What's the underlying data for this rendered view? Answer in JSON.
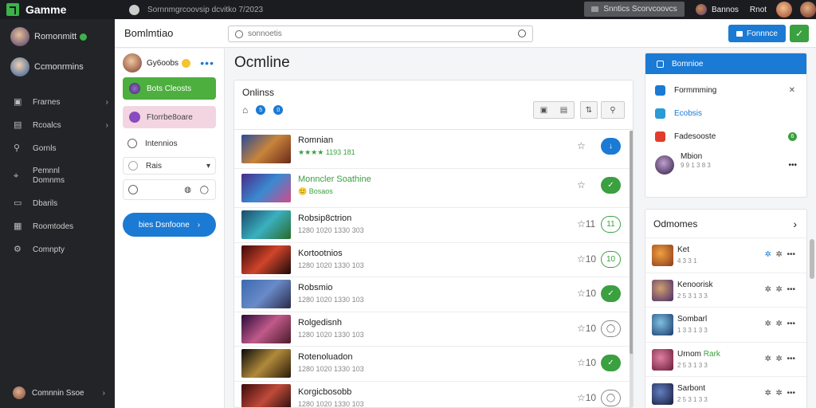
{
  "app": {
    "title": "Gamme"
  },
  "topbar": {
    "search_text": "Sornnmgrcoovsip dcvitko 7/2023",
    "button_label": "Snntics Scorvcoovcs",
    "user_name": "Bannos",
    "user_label": "Rnot"
  },
  "sidebar": {
    "users": [
      {
        "name": "Romonmitt",
        "status_color": "#3bb34a"
      },
      {
        "name": "Ccmonrmins"
      }
    ],
    "items": [
      {
        "label": "Frarnes",
        "icon": "gamepad-icon",
        "glyph": "▣",
        "chevron": true
      },
      {
        "label": "Rcoalcs",
        "icon": "bag-icon",
        "glyph": "▤",
        "chevron": true
      },
      {
        "label": "Gornls",
        "icon": "search-icon",
        "glyph": "⚲",
        "chevron": false
      },
      {
        "label": "Pemnnl Domnms",
        "icon": "pin-icon",
        "glyph": "⌖",
        "chevron": false
      },
      {
        "label": "Dbarils",
        "icon": "monitor-icon",
        "glyph": "▭",
        "chevron": false
      },
      {
        "label": "Roomtodes",
        "icon": "grid-icon",
        "glyph": "▦",
        "chevron": false
      },
      {
        "label": "Comnpty",
        "icon": "settings-icon",
        "glyph": "⚙",
        "chevron": false
      }
    ],
    "bottom_label": "Comnnin Ssoe"
  },
  "header": {
    "title": "Bomlmtiao",
    "search_placeholder": "sonnoetis",
    "primary_button": "Fonnnce",
    "confirm_glyph": "✓"
  },
  "column2": {
    "profile_name": "Gy6oobs",
    "dots": "•••",
    "pill1": "Bots Cleosts",
    "pill2": "Ftorrbe8oare",
    "field1": "Intennios",
    "field2": "Rais",
    "field2_arrow": "▾",
    "field3_icons": [
      "◍",
      "◯"
    ],
    "big_button": "bies Dsnfoone"
  },
  "main": {
    "heading": "Ocmline",
    "panel_title": "Onlinss",
    "filter_chips": [
      "5",
      "0"
    ],
    "rows": [
      {
        "name": "Romnian",
        "meta": "★★★★ 1193 181",
        "like": "☆",
        "action": "↓",
        "style": "blue"
      },
      {
        "name": "Monncler Soathine",
        "meta": "🙂 Bosaos",
        "like": "☆",
        "action": "✓",
        "style": "green"
      },
      {
        "name": "Robsip8ctrion",
        "meta": "1280 1020 1330 303",
        "like": "☆11",
        "action": "11",
        "style": "outg"
      },
      {
        "name": "Kortootnios",
        "meta": "1280 1020 1330 103",
        "like": "☆10",
        "action": "10",
        "style": "outg"
      },
      {
        "name": "Robsmio",
        "meta": "1280 1020 1330 103",
        "like": "☆10",
        "action": "✓",
        "style": "green"
      },
      {
        "name": "Rolgedisnh",
        "meta": "1280 1020 1330 103",
        "like": "☆10",
        "action": "◯",
        "style": "outk"
      },
      {
        "name": "Rotenoluadon",
        "meta": "1280 1020 1330 103",
        "like": "☆10",
        "action": "✓",
        "style": "green"
      },
      {
        "name": "Korgicbosobb",
        "meta": "1280 1020 1330 103",
        "like": "☆10",
        "action": "◯",
        "style": "outk"
      }
    ]
  },
  "right": {
    "top_header": "Bomnioe",
    "items": [
      {
        "label": "Formmming",
        "color": "#1a7ad4",
        "trail": "✕"
      },
      {
        "label": "Ecobsis",
        "color": "#2a9bd6",
        "trail": ""
      },
      {
        "label": "Fadesooste",
        "color": "#e23c2c",
        "trail": "6"
      },
      {
        "label": "Mbion",
        "sub": "9 9 1 3 8 3",
        "trail": "•••"
      }
    ],
    "friends_title": "Odmomes",
    "friends_arrow": "›",
    "friends": [
      {
        "name": "Ket",
        "meta": "4 3 3 1"
      },
      {
        "name": "Kenoorisk",
        "meta": "2 5 3 1 3 3"
      },
      {
        "name": "Sombarl",
        "meta": "1 3 3 1 3 3"
      },
      {
        "name": "Urnom Rark",
        "meta": "2 5 3 1 3 3"
      },
      {
        "name": "Sarbont",
        "meta": "2 5 3 1 3 3"
      }
    ]
  }
}
